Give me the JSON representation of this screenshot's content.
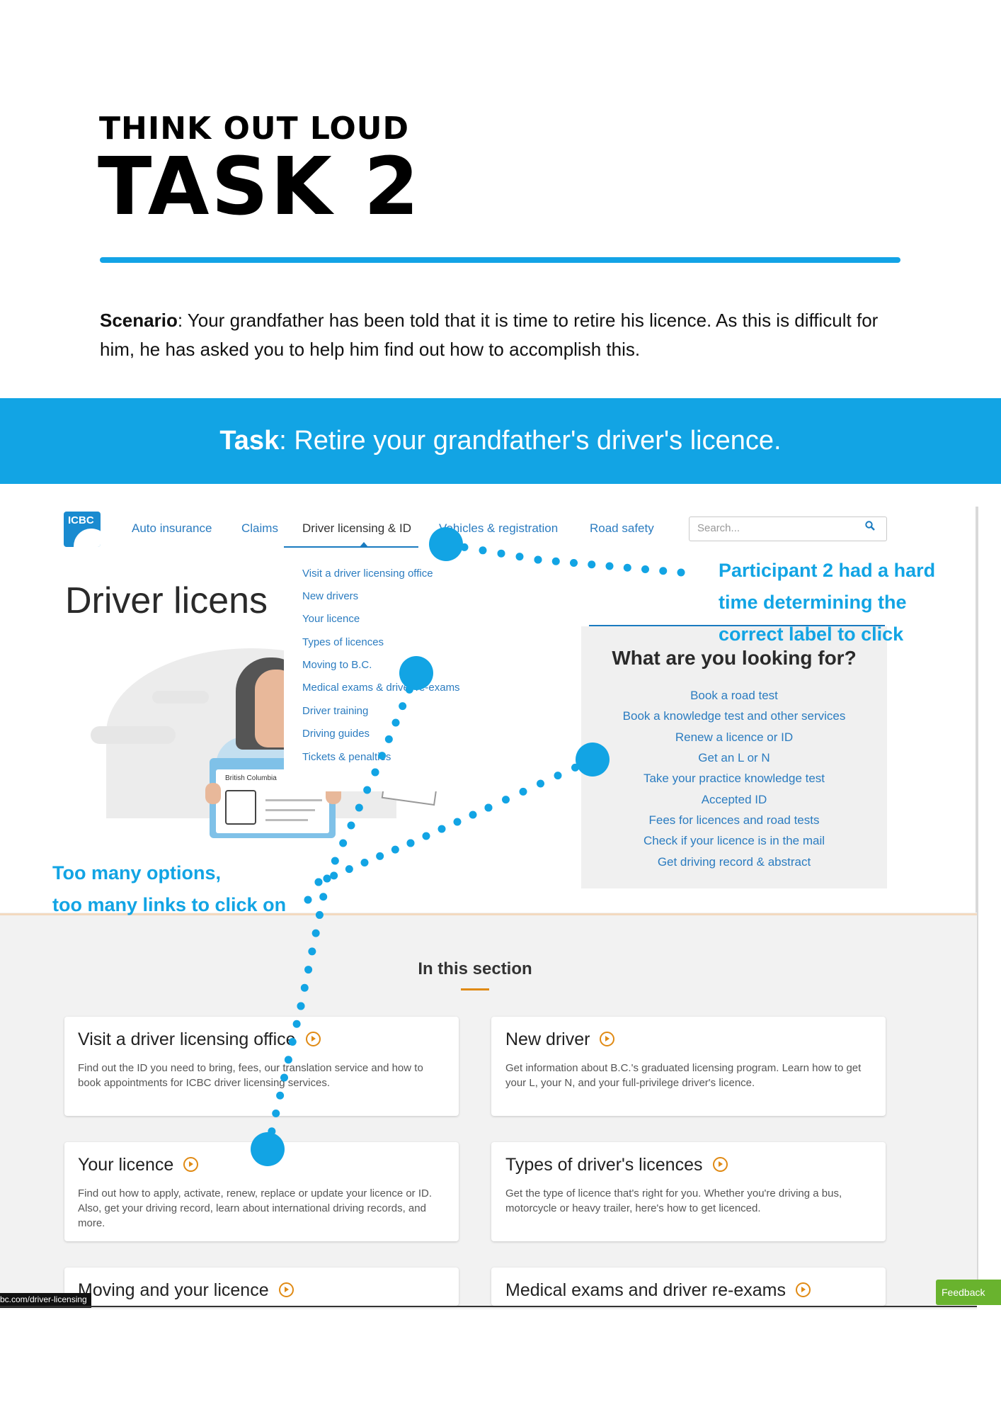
{
  "header": {
    "kicker": "THINK OUT LOUD",
    "title": "TASK 2"
  },
  "scenario": {
    "label": "Scenario",
    "text": ": Your grandfather has been told that it is time to retire his licence. As this is difficult for him, he has asked you to help him find out how to accomplish this."
  },
  "task": {
    "label": "Task",
    "text": ": Retire your grandfather's driver's licence."
  },
  "site": {
    "logo_text": "ICBC",
    "nav": [
      "Auto insurance",
      "Claims",
      "Driver licensing & ID",
      "Vehicles & registration",
      "Road safety"
    ],
    "search_placeholder": "Search...",
    "page_title": "Driver licens",
    "dropdown": [
      "Visit a driver licensing office",
      "New drivers",
      "Your licence",
      "Types of licences",
      "Moving to B.C.",
      "Medical exams & driver re-exams",
      "Driver training",
      "Driving guides",
      "Tickets & penalties"
    ],
    "id_card_label": "British Columbia",
    "looking_for": {
      "title": "What are you looking for?",
      "links": [
        "Book a road test",
        "Book a knowledge test and other services",
        "Renew a licence or ID",
        "Get an L or N",
        "Take your practice knowledge test",
        "Accepted ID",
        "Fees for licences and road tests",
        "Check if your licence is in the mail",
        "Get driving record & abstract"
      ]
    },
    "section_title": "In this section",
    "cards": [
      {
        "title": "Visit a driver licensing office",
        "desc": "Find out the ID you need to bring, fees, our translation service and how to book appointments for ICBC driver licensing services."
      },
      {
        "title": "New driver",
        "desc": "Get information about B.C.'s graduated licensing program. Learn how to get your L, your N, and your full-privilege driver's licence."
      },
      {
        "title": "Your licence",
        "desc": "Find out how to apply, activate, renew, replace or update your licence or ID. Also, get your driving record, learn about international driving records, and more."
      },
      {
        "title": "Types of driver's licences",
        "desc": "Get the type of licence that's right for you. Whether you're driving a bus, motorcycle or heavy trailer, here's how to get licenced."
      },
      {
        "title": "Moving and your licence",
        "desc": ""
      },
      {
        "title": "Medical exams and driver re-exams",
        "desc": ""
      }
    ],
    "status_url": "bc.com/driver-licensing",
    "feedback": "Feedback"
  },
  "annotations": {
    "participant_note": [
      "Participant 2 had a hard",
      "time determining the",
      "correct label to click"
    ],
    "options_note": [
      "Too many options,",
      "too many links to click on"
    ]
  },
  "colors": {
    "accent_blue": "#12a4e4",
    "link_blue": "#2b7cc0",
    "orange": "#e08a14",
    "feedback_green": "#69b32e"
  }
}
